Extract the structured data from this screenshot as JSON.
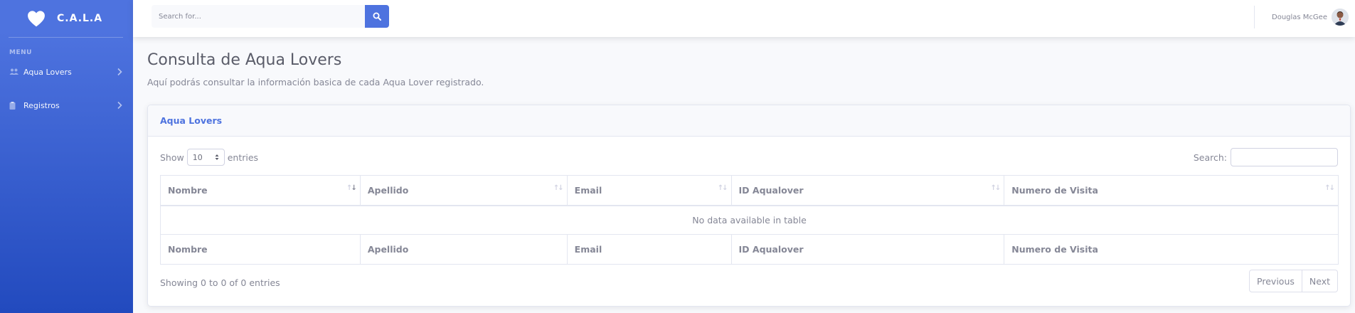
{
  "sidebar": {
    "brand": "C.A.L.A",
    "heading": "MENU",
    "items": [
      {
        "label": "Aqua Lovers",
        "icon": "users-icon"
      },
      {
        "label": "Registros",
        "icon": "clipboard-icon"
      }
    ]
  },
  "topbar": {
    "search_placeholder": "Search for...",
    "user_name": "Douglas McGee"
  },
  "page": {
    "title": "Consulta de Aqua Lovers",
    "subtitle": "Aquí podrás consultar la información basica de cada Aqua Lover registrado."
  },
  "card": {
    "title": "Aqua Lovers",
    "length": {
      "prefix": "Show",
      "value": "10",
      "suffix": "entries"
    },
    "search_label": "Search:",
    "columns": [
      "Nombre",
      "Apellido",
      "Email",
      "ID Aqualover",
      "Numero de Visita"
    ],
    "empty_message": "No data available in table",
    "info": "Showing 0 to 0 of 0 entries",
    "pager": {
      "previous": "Previous",
      "next": "Next"
    }
  },
  "colors": {
    "primary": "#4e73df",
    "sidebar_gradient_end": "#224abe",
    "text": "#858796"
  }
}
